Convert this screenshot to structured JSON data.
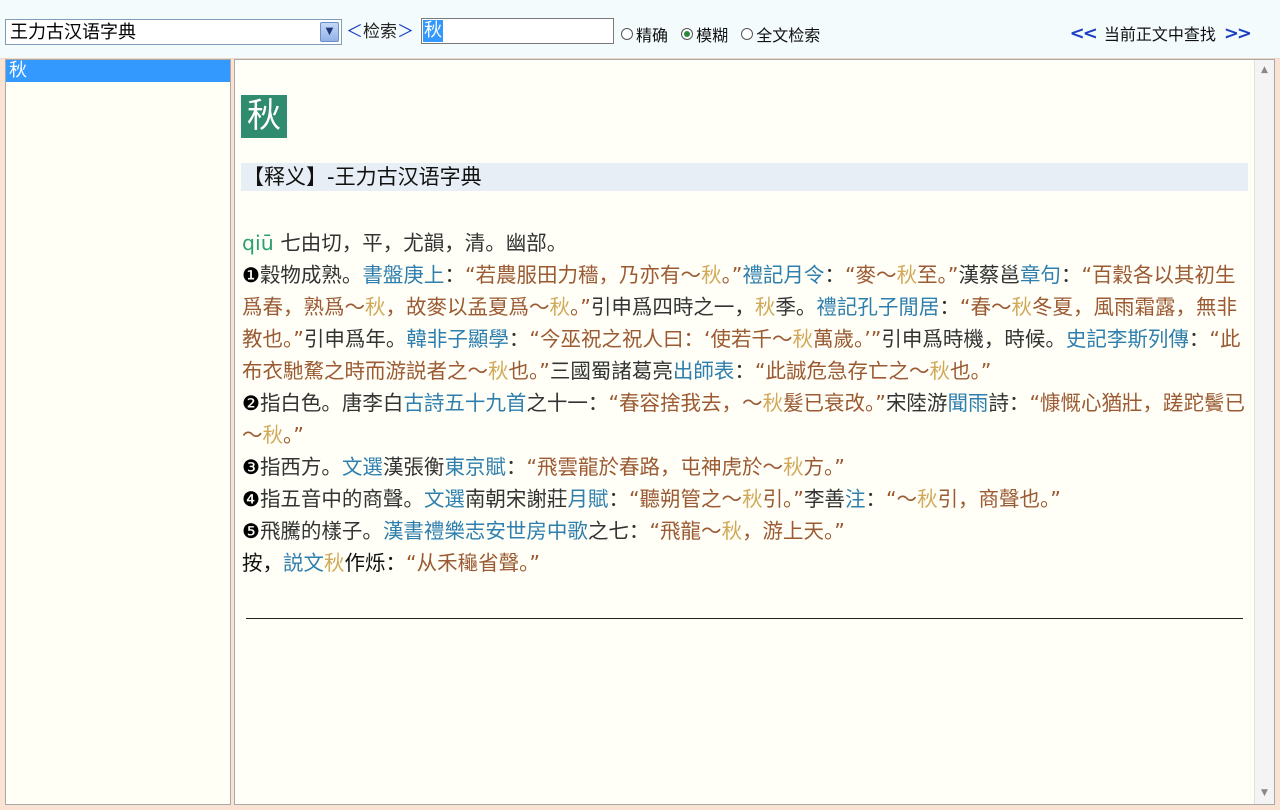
{
  "toolbar": {
    "dictionary": "王力古汉语字典",
    "search_label": "检索",
    "search_value": "秋",
    "modes": [
      {
        "label": "精确",
        "selected": false
      },
      {
        "label": "模糊",
        "selected": true
      },
      {
        "label": "全文检索",
        "selected": false
      }
    ],
    "find_prev": "<<",
    "find_text": "当前正文中查找",
    "find_next": ">>"
  },
  "results": [
    "秋"
  ],
  "entry": {
    "headword": "秋",
    "section_title": "【释义】-王力古汉语字典",
    "pinyin": "qiū",
    "phonetic": " 七由切，平，尤韻，清。幽部。",
    "senses": [
      {
        "num": "❶",
        "segs": [
          [
            "t",
            "穀物成熟。"
          ],
          [
            "b",
            "書盤庚上"
          ],
          [
            "t",
            "："
          ],
          [
            "q",
            "“若農服田力穡，乃亦有～"
          ],
          [
            "k",
            "秋"
          ],
          [
            "q",
            "。”"
          ],
          [
            "b",
            "禮記月令"
          ],
          [
            "t",
            "："
          ],
          [
            "q",
            "“麥～"
          ],
          [
            "k",
            "秋"
          ],
          [
            "q",
            "至。”"
          ],
          [
            "t",
            "漢蔡邕"
          ],
          [
            "b",
            "章句"
          ],
          [
            "t",
            "："
          ],
          [
            "q",
            "“百穀各以其初生爲春，熟爲～"
          ],
          [
            "k",
            "秋"
          ],
          [
            "q",
            "，故麥以孟夏爲～"
          ],
          [
            "k",
            "秋"
          ],
          [
            "q",
            "。”"
          ],
          [
            "t",
            "引申爲四時之一，"
          ],
          [
            "k",
            "秋"
          ],
          [
            "t",
            "季。"
          ],
          [
            "b",
            "禮記孔子閒居"
          ],
          [
            "t",
            "："
          ],
          [
            "q",
            "“春～"
          ],
          [
            "k",
            "秋"
          ],
          [
            "q",
            "冬夏，風雨霜露，無非教也。”"
          ],
          [
            "t",
            "引申爲年。"
          ],
          [
            "b",
            "韓非子顯學"
          ],
          [
            "t",
            "："
          ],
          [
            "q",
            "“今巫祝之祝人曰：‘使若千～"
          ],
          [
            "k",
            "秋"
          ],
          [
            "q",
            "萬歲。’”"
          ],
          [
            "t",
            "引申爲時機，時候。"
          ],
          [
            "b",
            "史記李斯列傳"
          ],
          [
            "t",
            "："
          ],
          [
            "q",
            "“此布衣馳騖之時而游説者之～"
          ],
          [
            "k",
            "秋"
          ],
          [
            "q",
            "也。”"
          ],
          [
            "t",
            "三國蜀諸葛亮"
          ],
          [
            "b",
            "出師表"
          ],
          [
            "t",
            "："
          ],
          [
            "q",
            "“此誠危急存亡之～"
          ],
          [
            "k",
            "秋"
          ],
          [
            "q",
            "也。”"
          ]
        ]
      },
      {
        "num": "❷",
        "segs": [
          [
            "t",
            "指白色。唐李白"
          ],
          [
            "b",
            "古詩五十九首"
          ],
          [
            "t",
            "之十一："
          ],
          [
            "q",
            "“春容捨我去，～"
          ],
          [
            "k",
            "秋"
          ],
          [
            "q",
            "髮已衰改。”"
          ],
          [
            "t",
            "宋陸游"
          ],
          [
            "b",
            "聞雨"
          ],
          [
            "t",
            "詩："
          ],
          [
            "q",
            "“慷慨心猶壯，蹉跎鬢已～"
          ],
          [
            "k",
            "秋"
          ],
          [
            "q",
            "。”"
          ]
        ]
      },
      {
        "num": "❸",
        "segs": [
          [
            "t",
            "指西方。"
          ],
          [
            "b",
            "文選"
          ],
          [
            "t",
            "漢張衡"
          ],
          [
            "b",
            "東京賦"
          ],
          [
            "t",
            "："
          ],
          [
            "q",
            "“飛雲龍於春路，屯神虎於～"
          ],
          [
            "k",
            "秋"
          ],
          [
            "q",
            "方。”"
          ]
        ]
      },
      {
        "num": "❹",
        "segs": [
          [
            "t",
            "指五音中的商聲。"
          ],
          [
            "b",
            "文選"
          ],
          [
            "t",
            "南朝宋謝莊"
          ],
          [
            "b",
            "月賦"
          ],
          [
            "t",
            "："
          ],
          [
            "q",
            "“聽朔管之～"
          ],
          [
            "k",
            "秋"
          ],
          [
            "q",
            "引。”"
          ],
          [
            "t",
            "李善"
          ],
          [
            "b",
            "注"
          ],
          [
            "t",
            "："
          ],
          [
            "q",
            "“～"
          ],
          [
            "k",
            "秋"
          ],
          [
            "q",
            "引，商聲也。”"
          ]
        ]
      },
      {
        "num": "❺",
        "segs": [
          [
            "t",
            "飛騰的樣子。"
          ],
          [
            "b",
            "漢書禮樂志安世房中歌"
          ],
          [
            "t",
            "之七："
          ],
          [
            "q",
            "“飛龍～"
          ],
          [
            "k",
            "秋"
          ],
          [
            "q",
            "，游上天。”"
          ]
        ]
      },
      {
        "num": "",
        "segs": [
          [
            "blk",
            "按，"
          ],
          [
            "b",
            "説文"
          ],
          [
            "k",
            "秋"
          ],
          [
            "blk",
            "作烁："
          ],
          [
            "q",
            "“从禾龝省聲。”"
          ]
        ]
      }
    ]
  }
}
